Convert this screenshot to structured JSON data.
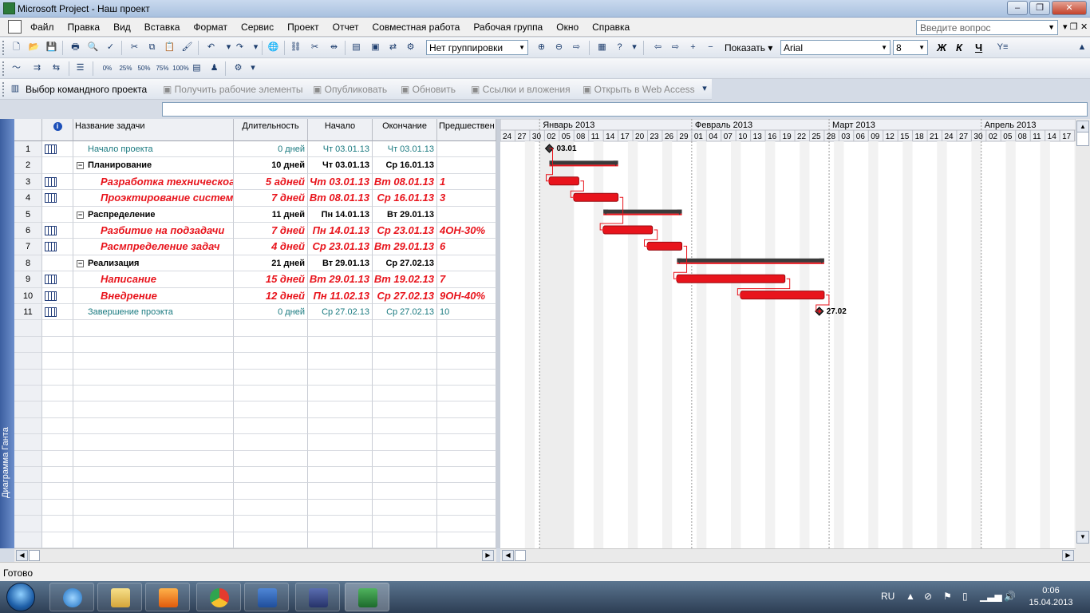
{
  "window": {
    "title": "Microsoft Project - Наш проект"
  },
  "menu": {
    "items": [
      "Файл",
      "Правка",
      "Вид",
      "Вставка",
      "Формат",
      "Сервис",
      "Проект",
      "Отчет",
      "Совместная работа",
      "Рабочая группа",
      "Окно",
      "Справка"
    ],
    "help_placeholder": "Введите вопрос"
  },
  "toolbar1": {
    "grouping": "Нет группировки",
    "show_label": "Показать",
    "font": "Arial",
    "font_size": "8",
    "bold": "Ж",
    "italic": "К",
    "underline": "Ч"
  },
  "toolbar2": {
    "pct_labels": [
      "0%",
      "25%",
      "50%",
      "75%",
      "100%"
    ]
  },
  "toolbar3": {
    "items": [
      {
        "label": "Выбор командного проекта",
        "enabled": true
      },
      {
        "label": "Получить рабочие элементы",
        "enabled": false
      },
      {
        "label": "Опубликовать",
        "enabled": false
      },
      {
        "label": "Обновить",
        "enabled": false
      },
      {
        "label": "Ссылки и вложения",
        "enabled": false
      },
      {
        "label": "Открыть в Web Access",
        "enabled": false
      }
    ]
  },
  "view_bar": {
    "label": "Диаграмма Ганта"
  },
  "table": {
    "headers": {
      "name": "Название задачи",
      "duration": "Длительность",
      "start": "Начало",
      "finish": "Окончание",
      "predecessors": "Предшествен"
    },
    "rows": [
      {
        "id": "1",
        "name": "Начало проекта",
        "duration": "0 дней",
        "start": "Чт 03.01.13",
        "finish": "Чт 03.01.13",
        "pred": "",
        "style": "milestone",
        "indent": 1
      },
      {
        "id": "2",
        "name": "Планирование",
        "duration": "10 дней",
        "start": "Чт 03.01.13",
        "finish": "Ср 16.01.13",
        "pred": "",
        "style": "summary",
        "indent": 0
      },
      {
        "id": "3",
        "name": "Разработка техническоаго",
        "duration": "5 адней",
        "start": "Чт 03.01.13",
        "finish": "Вт 08.01.13",
        "pred": "1",
        "style": "critical",
        "indent": 2
      },
      {
        "id": "4",
        "name": "Проэктирование системы",
        "duration": "7 дней",
        "start": "Вт 08.01.13",
        "finish": "Ср 16.01.13",
        "pred": "3",
        "style": "critical",
        "indent": 2
      },
      {
        "id": "5",
        "name": "Распределение",
        "duration": "11 дней",
        "start": "Пн 14.01.13",
        "finish": "Вт 29.01.13",
        "pred": "",
        "style": "summary",
        "indent": 0
      },
      {
        "id": "6",
        "name": "Разбитие на подзадачи",
        "duration": "7 дней",
        "start": "Пн 14.01.13",
        "finish": "Ср 23.01.13",
        "pred": "4ОН-30%",
        "style": "critical",
        "indent": 2
      },
      {
        "id": "7",
        "name": "Расмпределение задач",
        "duration": "4 дней",
        "start": "Ср 23.01.13",
        "finish": "Вт 29.01.13",
        "pred": "6",
        "style": "critical",
        "indent": 2
      },
      {
        "id": "8",
        "name": "Реализация",
        "duration": "21 дней",
        "start": "Вт 29.01.13",
        "finish": "Ср 27.02.13",
        "pred": "",
        "style": "summary",
        "indent": 0
      },
      {
        "id": "9",
        "name": "Написание",
        "duration": "15 дней",
        "start": "Вт 29.01.13",
        "finish": "Вт 19.02.13",
        "pred": "7",
        "style": "critical",
        "indent": 2
      },
      {
        "id": "10",
        "name": "Внедрение",
        "duration": "12 дней",
        "start": "Пн 11.02.13",
        "finish": "Ср 27.02.13",
        "pred": "9ОН-40%",
        "style": "critical",
        "indent": 2
      },
      {
        "id": "11",
        "name": "Завершение проэкта",
        "duration": "0 дней",
        "start": "Ср 27.02.13",
        "finish": "Ср 27.02.13",
        "pred": "10",
        "style": "milestone",
        "indent": 1
      }
    ]
  },
  "gantt": {
    "months": [
      "Январь 2013",
      "Февраль 2013",
      "Март 2013",
      "Апрель 2013"
    ],
    "day_labels": [
      "24",
      "27",
      "30",
      "02",
      "05",
      "08",
      "11",
      "14",
      "17",
      "20",
      "23",
      "26",
      "29",
      "01",
      "04",
      "07",
      "10",
      "13",
      "16",
      "19",
      "22",
      "25",
      "28",
      "03",
      "06",
      "09",
      "12",
      "15",
      "18",
      "21",
      "24",
      "27",
      "30",
      "02",
      "05",
      "08",
      "11",
      "14",
      "17",
      "20"
    ],
    "milestone_labels": [
      "03.01",
      "27.02"
    ],
    "colors": {
      "critical": "#e8141c",
      "summary": "#3a3a3a",
      "milestone": "#3a3a3a"
    },
    "bars": [
      {
        "row": 0,
        "type": "milestone",
        "start": "2013-01-03",
        "label": "03.01"
      },
      {
        "row": 1,
        "type": "summary",
        "start": "2013-01-03",
        "end": "2013-01-16"
      },
      {
        "row": 2,
        "type": "task",
        "start": "2013-01-03",
        "end": "2013-01-08"
      },
      {
        "row": 3,
        "type": "task",
        "start": "2013-01-08",
        "end": "2013-01-16"
      },
      {
        "row": 4,
        "type": "summary",
        "start": "2013-01-14",
        "end": "2013-01-29"
      },
      {
        "row": 5,
        "type": "task",
        "start": "2013-01-14",
        "end": "2013-01-23"
      },
      {
        "row": 6,
        "type": "task",
        "start": "2013-01-23",
        "end": "2013-01-29"
      },
      {
        "row": 7,
        "type": "summary",
        "start": "2013-01-29",
        "end": "2013-02-27"
      },
      {
        "row": 8,
        "type": "task",
        "start": "2013-01-29",
        "end": "2013-02-19"
      },
      {
        "row": 9,
        "type": "task",
        "start": "2013-02-11",
        "end": "2013-02-27"
      },
      {
        "row": 10,
        "type": "milestone",
        "start": "2013-02-27",
        "label": "27.02"
      }
    ],
    "links": [
      [
        0,
        2
      ],
      [
        2,
        3
      ],
      [
        3,
        5
      ],
      [
        5,
        6
      ],
      [
        6,
        8
      ],
      [
        8,
        9
      ],
      [
        9,
        10
      ]
    ]
  },
  "status": {
    "text": "Готово"
  },
  "taskbar": {
    "lang": "RU",
    "time": "0:06",
    "date": "15.04.2013"
  }
}
